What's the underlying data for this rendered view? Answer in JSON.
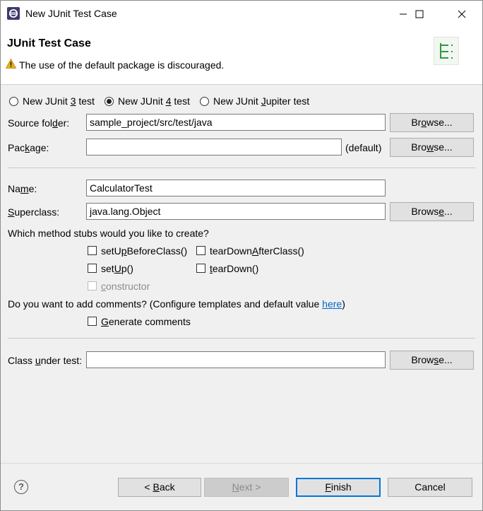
{
  "window": {
    "title": "New JUnit Test Case",
    "controls": {
      "minimize": "—",
      "maximize": "☐",
      "close": "✕"
    }
  },
  "header": {
    "title": "JUnit Test Case",
    "warning": "The use of the default package is discouraged."
  },
  "junit_version": {
    "options": [
      {
        "pre": "New JUnit ",
        "key": "3",
        "post": " test",
        "checked": false
      },
      {
        "pre": "New JUnit ",
        "key": "4",
        "post": " test",
        "checked": true
      },
      {
        "pre": "New JUnit ",
        "key": "J",
        "post": "upiter test",
        "checked": false
      }
    ]
  },
  "source_folder": {
    "label_pre": "Source fol",
    "label_key": "d",
    "label_post": "er:",
    "value": "sample_project/src/test/java",
    "browse_pre": "Br",
    "browse_key": "o",
    "browse_post": "wse..."
  },
  "package": {
    "label_pre": "Pac",
    "label_key": "k",
    "label_post": "age:",
    "value": "",
    "default_label": "(default)",
    "browse_pre": "Bro",
    "browse_key": "w",
    "browse_post": "se..."
  },
  "name": {
    "label_pre": "Na",
    "label_key": "m",
    "label_post": "e:",
    "value": "CalculatorTest"
  },
  "superclass": {
    "label_pre": "",
    "label_key": "S",
    "label_post": "uperclass:",
    "value": "java.lang.Object",
    "browse_pre": "Brows",
    "browse_key": "e",
    "browse_post": "..."
  },
  "stubs": {
    "question": "Which method stubs would you like to create?",
    "setUpBeforeClass": {
      "pre": "setU",
      "key": "p",
      "post": "BeforeClass()",
      "checked": false
    },
    "tearDownAfterClass": {
      "pre": "tearDown",
      "key": "A",
      "post": "fterClass()",
      "checked": false
    },
    "setUp": {
      "pre": "set",
      "key": "U",
      "post": "p()",
      "checked": false
    },
    "tearDown": {
      "pre": "",
      "key": "t",
      "post": "earDown()",
      "checked": false
    },
    "constructor": {
      "pre": "",
      "key": "c",
      "post": "onstructor",
      "checked": false,
      "disabled": true
    }
  },
  "comments": {
    "question_pre": "Do you want to add comments? (Configure templates and default value ",
    "question_link": "here",
    "question_post": ")",
    "generate": {
      "pre": "",
      "key": "G",
      "post": "enerate comments",
      "checked": false
    }
  },
  "class_under_test": {
    "label_pre": "Class ",
    "label_key": "u",
    "label_post": "nder test:",
    "value": "",
    "browse_pre": "Brow",
    "browse_key": "s",
    "browse_post": "e..."
  },
  "footer": {
    "help_icon": "?",
    "back": {
      "pre": "< ",
      "key": "B",
      "post": "ack"
    },
    "next": {
      "pre": "",
      "key": "N",
      "post": "ext >"
    },
    "finish": {
      "pre": "",
      "key": "F",
      "post": "inish"
    },
    "cancel": "Cancel"
  },
  "colors": {
    "accent": "#0078d7",
    "link": "#0066cc",
    "warning": "#e8b21c"
  }
}
